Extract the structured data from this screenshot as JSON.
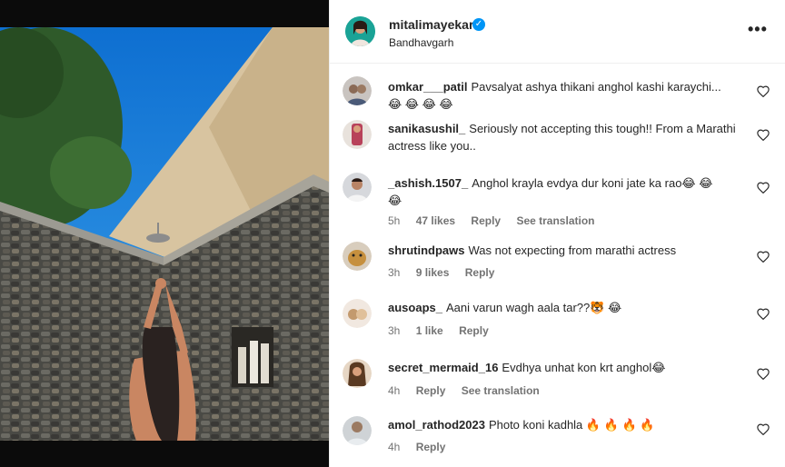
{
  "post": {
    "owner": "mitalimayekar",
    "location": "Bandhavgarh",
    "more_label": "•••",
    "verified_mark": "✓"
  },
  "comments": [
    {
      "user": "omkar___patil",
      "text": "Pavsalyat ashya thikani anghol kashi karaychi...",
      "emoji": "😂 😂 😂 😂",
      "time": "",
      "likes": "",
      "reply": "",
      "translate": ""
    },
    {
      "user": "sanikasushil_",
      "text": "Seriously not accepting this tough!! From a Marathi actress like you..",
      "emoji": "",
      "time": "",
      "likes": "",
      "reply": "",
      "translate": ""
    },
    {
      "user": "_ashish.1507_",
      "text": "Anghol krayla evdya dur koni jate ka rao😂 😂",
      "emoji": "😂",
      "time": "5h",
      "likes": "47 likes",
      "reply": "Reply",
      "translate": "See translation"
    },
    {
      "user": "shrutindpaws",
      "text": "Was not expecting from marathi actress",
      "emoji": "",
      "time": "3h",
      "likes": "9 likes",
      "reply": "Reply",
      "translate": ""
    },
    {
      "user": "ausoaps_",
      "text": "Aani varun wagh aala tar??🐯 😂",
      "emoji": "",
      "time": "3h",
      "likes": "1 like",
      "reply": "Reply",
      "translate": ""
    },
    {
      "user": "secret_mermaid_16",
      "text": "Evdhya unhat kon krt anghol😂",
      "emoji": "",
      "time": "4h",
      "likes": "",
      "reply": "Reply",
      "translate": "See translation"
    },
    {
      "user": "amol_rathod2023",
      "text": "Photo koni kadhla 🔥 🔥 🔥 🔥",
      "emoji": "",
      "time": "4h",
      "likes": "",
      "reply": "Reply",
      "translate": ""
    }
  ],
  "colors": {
    "accent_blue": "#0095f6",
    "meta_gray": "#737373",
    "text_dark": "#262626"
  },
  "icons": {
    "heart": "heart-outline-icon",
    "more": "more-options-icon",
    "verified": "verified-badge-icon"
  }
}
